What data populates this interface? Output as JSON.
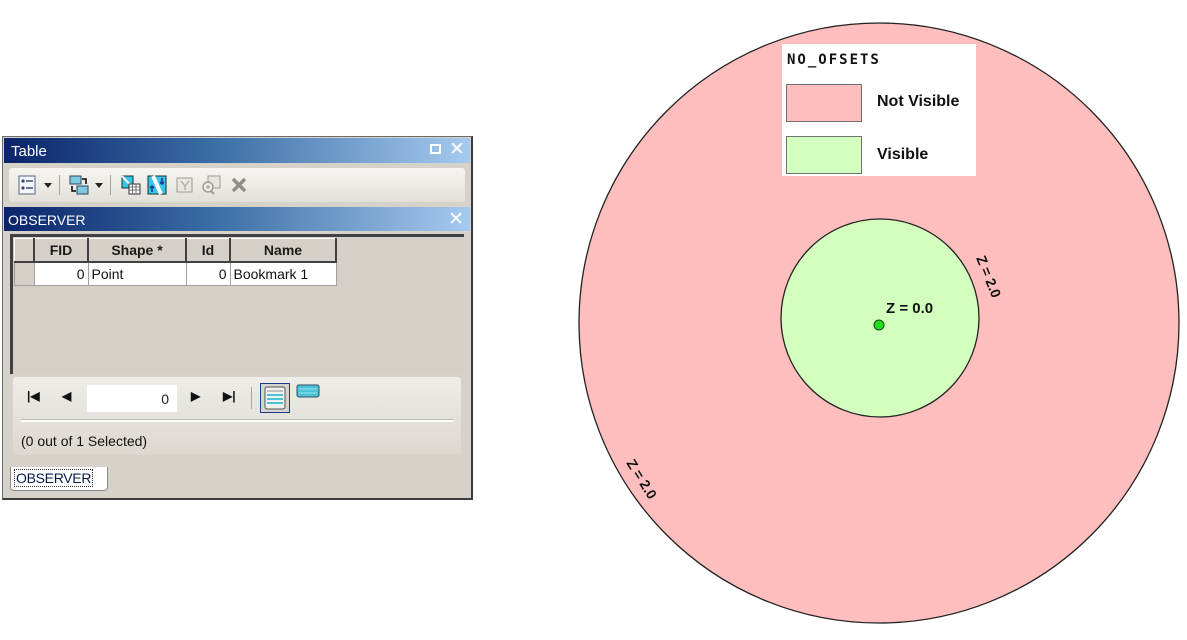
{
  "window": {
    "title": "Table",
    "maximize_label": "maximize",
    "close_label": "close"
  },
  "toolbar": {
    "items": [
      {
        "name": "table-options",
        "icon": "table-options-icon",
        "has_dropdown": true
      },
      {
        "name": "related-tables",
        "icon": "related-tables-icon",
        "has_dropdown": true
      },
      {
        "name": "select-by-attributes",
        "icon": "select-by-attributes-icon",
        "enabled": true
      },
      {
        "name": "switch-selection",
        "icon": "switch-selection-icon",
        "enabled": true
      },
      {
        "name": "clear-selection",
        "icon": "clear-selection-icon",
        "enabled": false
      },
      {
        "name": "zoom-to-selected",
        "icon": "zoom-to-selected-icon",
        "enabled": false
      },
      {
        "name": "delete-selected",
        "icon": "delete-icon",
        "enabled": false
      }
    ]
  },
  "layer_tab": {
    "title": "OBSERVER"
  },
  "grid": {
    "columns": [
      "FID",
      "Shape *",
      "Id",
      "Name"
    ],
    "rows": [
      {
        "FID": "0",
        "Shape": "Point",
        "Id": "0",
        "Name": "Bookmark 1"
      }
    ]
  },
  "navigation": {
    "current_record": "0",
    "status": "(0 out of 1 Selected)"
  },
  "bottom_tab": {
    "label": "OBSERVER"
  },
  "map": {
    "legend": {
      "title": "NO_OFSETS",
      "items": [
        {
          "label": "Not Visible",
          "color": "#ffbebe"
        },
        {
          "label": "Visible",
          "color": "#d3ffbe"
        }
      ]
    },
    "labels": {
      "center": "Z = 0.0",
      "inner_ring": "Z = 2.0",
      "outer_ring": "Z = 2.0"
    },
    "colors": {
      "not_visible": "#ffbebe",
      "visible": "#d3ffbe",
      "observer_point": "#22dd22"
    }
  }
}
